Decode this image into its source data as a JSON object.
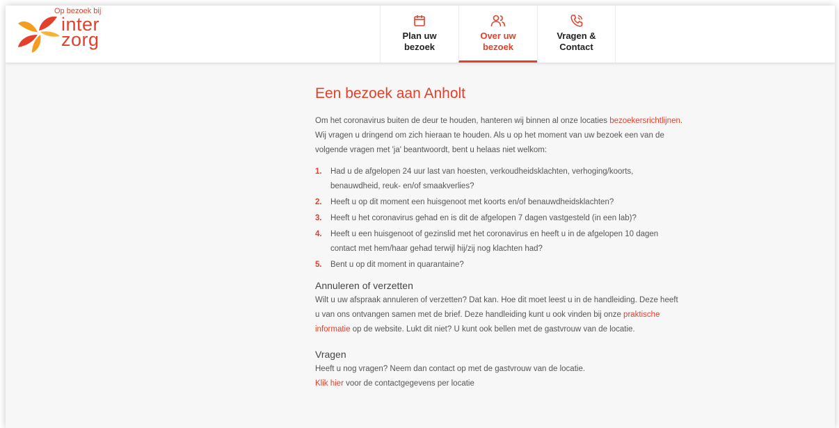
{
  "logo": {
    "tagline": "Op bezoek bij",
    "wordmark_line1": "inter",
    "wordmark_line2": "zorg"
  },
  "nav": {
    "items": [
      {
        "label": "Plan uw bezoek",
        "icon": "calendar-icon",
        "active": false
      },
      {
        "label": "Over uw bezoek",
        "icon": "users-icon",
        "active": true
      },
      {
        "label": "Vragen & Contact",
        "icon": "phone-call-icon",
        "active": false
      }
    ]
  },
  "colors": {
    "accent": "#e2402a",
    "text": "#555555",
    "background": "#f7f7f7"
  },
  "main": {
    "title": "Een bezoek aan Anholt",
    "intro_before": "Om het coronavirus buiten de deur te houden, hanteren wij binnen al onze locaties ",
    "intro_link": "bezoekersrichtlijnen",
    "intro_after": ". Wij vragen u dringend om zich hieraan te houden.  Als u op het moment van uw bezoek een van de volgende vragen met 'ja' beantwoordt, bent u helaas niet welkom:",
    "questions": [
      {
        "num": "1.",
        "text": "Had u de afgelopen 24 uur last van hoesten, verkoudheidsklachten, verhoging/koorts, benauwdheid, reuk- en/of smaakverlies?"
      },
      {
        "num": "2.",
        "text": "Heeft u op dit moment een huisgenoot met koorts en/of benauwdheidsklachten?"
      },
      {
        "num": "3.",
        "text": "Heeft u het coronavirus gehad en is dit de afgelopen 7 dagen vastgesteld (in een lab)?"
      },
      {
        "num": "4.",
        "text": "Heeft u een huisgenoot of gezinslid met het coronavirus en heeft u in de afgelopen 10 dagen contact met hem/haar gehad terwijl hij/zij nog klachten had?"
      },
      {
        "num": "5.",
        "text": "Bent u op dit moment in quarantaine?"
      }
    ],
    "cancel": {
      "heading": "Annuleren of verzetten",
      "text_before": "Wilt u uw afspraak annuleren of verzetten? Dat kan. Hoe dit moet leest u in de handleiding. Deze heeft u van ons ontvangen samen met de brief. Deze handleiding kunt u ook vinden bij onze ",
      "link": "praktische informatie",
      "text_after": " op de website. Lukt dit niet? U kunt ook bellen met de gastvrouw van de locatie."
    },
    "questions_section": {
      "heading": "Vragen",
      "text": "Heeft u nog vragen? Neem dan contact op met de gastvrouw van de locatie.",
      "link": "Klik hier",
      "text_after": " voor de contactgegevens per locatie"
    }
  }
}
